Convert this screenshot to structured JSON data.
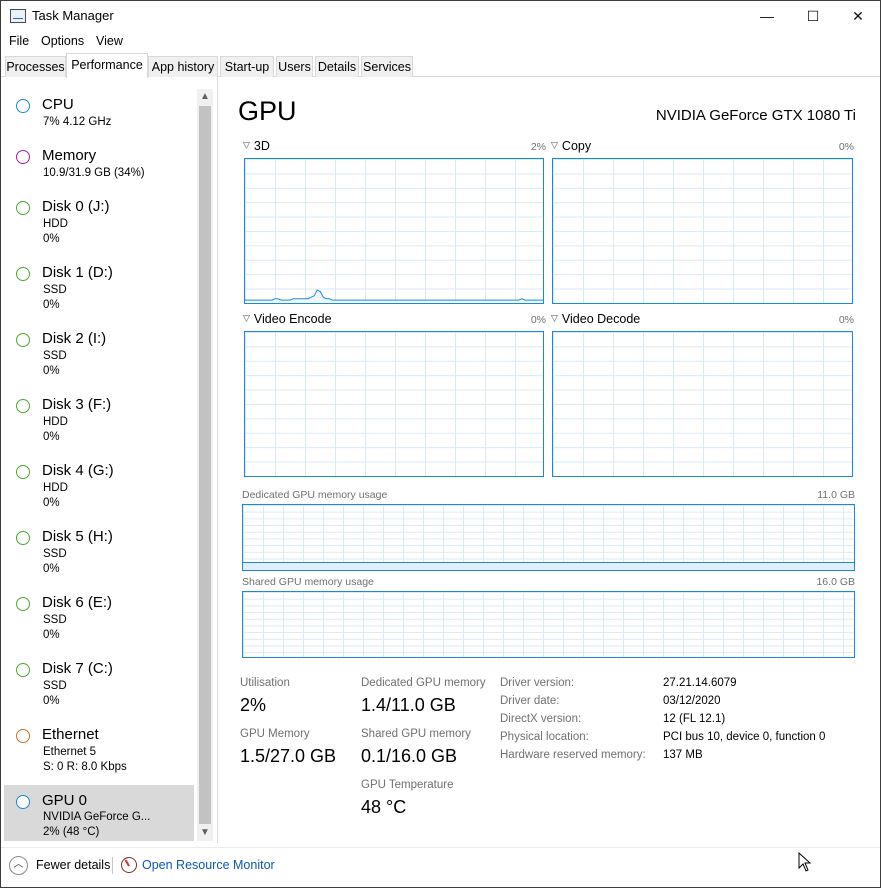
{
  "window": {
    "title": "Task Manager",
    "controls": {
      "minimize": "—",
      "maximize": "☐",
      "close": "✕"
    }
  },
  "menu": [
    "File",
    "Options",
    "View"
  ],
  "tabs": [
    "Processes",
    "Performance",
    "App history",
    "Start-up",
    "Users",
    "Details",
    "Services"
  ],
  "active_tab": "Performance",
  "sidebar": {
    "items": [
      {
        "title": "CPU",
        "lines": [
          "7% 4.12 GHz"
        ],
        "color": "#1c8ace",
        "selected": false
      },
      {
        "title": "Memory",
        "lines": [
          "10.9/31.9 GB (34%)"
        ],
        "color": "#a020a8",
        "selected": false
      },
      {
        "title": "Disk 0 (J:)",
        "lines": [
          "HDD",
          "0%"
        ],
        "color": "#4ca82c",
        "selected": false
      },
      {
        "title": "Disk 1 (D:)",
        "lines": [
          "SSD",
          "0%"
        ],
        "color": "#4ca82c",
        "selected": false
      },
      {
        "title": "Disk 2 (I:)",
        "lines": [
          "SSD",
          "0%"
        ],
        "color": "#4ca82c",
        "selected": false
      },
      {
        "title": "Disk 3 (F:)",
        "lines": [
          "HDD",
          "0%"
        ],
        "color": "#4ca82c",
        "selected": false
      },
      {
        "title": "Disk 4 (G:)",
        "lines": [
          "HDD",
          "0%"
        ],
        "color": "#4ca82c",
        "selected": false
      },
      {
        "title": "Disk 5 (H:)",
        "lines": [
          "SSD",
          "0%"
        ],
        "color": "#4ca82c",
        "selected": false
      },
      {
        "title": "Disk 6 (E:)",
        "lines": [
          "SSD",
          "0%"
        ],
        "color": "#4ca82c",
        "selected": false
      },
      {
        "title": "Disk 7 (C:)",
        "lines": [
          "SSD",
          "0%"
        ],
        "color": "#4ca82c",
        "selected": false
      },
      {
        "title": "Ethernet",
        "lines": [
          "Ethernet 5",
          "S: 0 R: 8.0 Kbps"
        ],
        "color": "#c8702a",
        "selected": false
      },
      {
        "title": "GPU 0",
        "lines": [
          "NVIDIA GeForce G...",
          "2% (48 °C)"
        ],
        "color": "#1c8ace",
        "selected": true
      }
    ]
  },
  "main": {
    "title": "GPU",
    "gpu_name": "NVIDIA GeForce GTX 1080 Ti",
    "engines": [
      {
        "name": "3D",
        "percent": "2%"
      },
      {
        "name": "Copy",
        "percent": "0%"
      },
      {
        "name": "Video Encode",
        "percent": "0%"
      },
      {
        "name": "Video Decode",
        "percent": "0%"
      }
    ],
    "dedicated_memory_graph": {
      "label": "Dedicated GPU memory usage",
      "max": "11.0 GB",
      "used_fraction": 0.13
    },
    "shared_memory_graph": {
      "label": "Shared GPU memory usage",
      "max": "16.0 GB",
      "used_fraction": 0.0
    },
    "stats": {
      "utilisation_label": "Utilisation",
      "utilisation": "2%",
      "gpu_memory_label": "GPU Memory",
      "gpu_memory": "1.5/27.0 GB",
      "dedicated_label": "Dedicated GPU memory",
      "dedicated": "1.4/11.0 GB",
      "shared_label": "Shared GPU memory",
      "shared": "0.1/16.0 GB",
      "temp_label": "GPU Temperature",
      "temp": "48 °C"
    },
    "info": [
      {
        "label": "Driver version:",
        "value": "27.21.14.6079"
      },
      {
        "label": "Driver date:",
        "value": "03/12/2020"
      },
      {
        "label": "DirectX version:",
        "value": "12 (FL 12.1)"
      },
      {
        "label": "Physical location:",
        "value": "PCI bus 10, device 0, function 0"
      },
      {
        "label": "Hardware reserved memory:",
        "value": "137 MB"
      }
    ]
  },
  "footer": {
    "fewer_details": "Fewer details",
    "resource_monitor": "Open Resource Monitor"
  },
  "chart_data": {
    "type": "line",
    "title": "3D",
    "series": [
      {
        "values": [
          2,
          2,
          2,
          2,
          2,
          2,
          2,
          2,
          2,
          2,
          3,
          3,
          2,
          2,
          2,
          2,
          3,
          3,
          3,
          3,
          3,
          3,
          4,
          5,
          9,
          8,
          4,
          3,
          3,
          2,
          2,
          2,
          2,
          2,
          2,
          2,
          2,
          2,
          2,
          2,
          2,
          2,
          2,
          2,
          2,
          2,
          2,
          2,
          2,
          2,
          2,
          2,
          2,
          2,
          2,
          2,
          2,
          2,
          2,
          2,
          2,
          2,
          2,
          2,
          2,
          2,
          2,
          2,
          2,
          2,
          2,
          2,
          2,
          2,
          2,
          2,
          2,
          2,
          2,
          2,
          2,
          2,
          2,
          2,
          2,
          2,
          2,
          2,
          2,
          2,
          2,
          2,
          3,
          2,
          2,
          2,
          2,
          2,
          2,
          2
        ]
      }
    ],
    "ylim": [
      0,
      100
    ]
  }
}
